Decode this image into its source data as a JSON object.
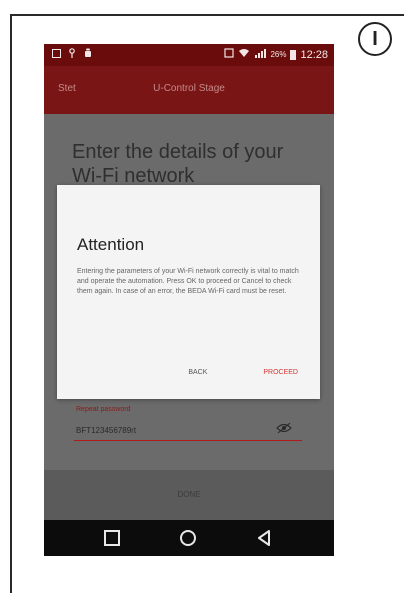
{
  "step_badge": "I",
  "status_bar": {
    "battery": "26%",
    "time": "12:28"
  },
  "app_bar": {
    "back_label": "Stet",
    "title": "U-Control Stage"
  },
  "content": {
    "title": "Enter the details of your Wi-Fi network"
  },
  "dialog": {
    "title": "Attention",
    "message": "Entering the parameters of your Wi-Fi network correctly is vital to match and operate the automation. Press OK to proceed or Cancel to check them again. In case of an error, the BEDA Wi-Fi card must be reset.",
    "back_button": "BACK",
    "proceed_button": "PROCEED"
  },
  "password_field": {
    "label": "Repeat password",
    "value": "BFT123456789rt"
  },
  "done_button": "DONE",
  "colors": {
    "status_bar": "#6a0c0c",
    "app_bar": "#7a1515",
    "accent": "#d23434",
    "overlay": "#6b6b6b"
  },
  "icons": [
    "image-icon",
    "location-icon",
    "android-icon",
    "screen-icon",
    "wifi-icon",
    "signal-icon",
    "battery-icon",
    "eye-icon",
    "nav-recent-icon",
    "nav-home-icon",
    "nav-back-icon"
  ]
}
